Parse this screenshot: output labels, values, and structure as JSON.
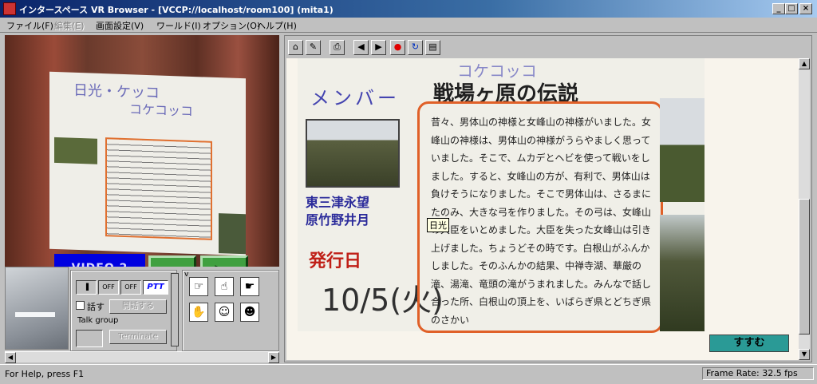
{
  "window": {
    "title": "インタースペース VR Browser  - [VCCP://localhost/room100] (mita1)",
    "min_glyph": "_",
    "max_glyph": "□",
    "close_glyph": "×"
  },
  "menu": {
    "items": [
      {
        "label": "ファイル(F)",
        "enabled": true
      },
      {
        "label": "編集(E)",
        "enabled": false
      },
      {
        "label": "画面設定(V)",
        "enabled": true
      },
      {
        "label": "ワールド(I)",
        "enabled": true
      },
      {
        "label": "オプション(O)",
        "enabled": true
      },
      {
        "label": "ヘルプ(H)",
        "enabled": true
      }
    ]
  },
  "viewport": {
    "board_title_1": "日光・ケッコ",
    "board_title_2": "コケコッコ",
    "video_label": "VIDEO 2",
    "rewind_icon": "rewind-icon",
    "play_icon": "play-icon"
  },
  "controls": {
    "v_label": "v",
    "toggles": [
      {
        "label": "▐",
        "name": "mic-toggle"
      },
      {
        "label": "OFF",
        "name": "off-toggle-1"
      },
      {
        "label": "OFF",
        "name": "off-toggle-2"
      },
      {
        "label": "PTT",
        "name": "ptt-toggle"
      }
    ],
    "talk_label": "話す",
    "start_talk_label": "開話する",
    "talk_group_label": "Talk group",
    "terminate_label": "Terminate",
    "gestures": [
      "bow-gesture-icon",
      "wave-gesture-icon",
      "point-gesture-icon",
      "clap-gesture-icon",
      "refuse-gesture-icon",
      "cheer-gesture-icon"
    ]
  },
  "browser": {
    "toolbar": [
      {
        "name": "home-icon",
        "glyph": "⌂"
      },
      {
        "name": "edit-icon",
        "glyph": "✎"
      },
      {
        "name": "print-icon",
        "glyph": "⎙"
      },
      {
        "name": "back-icon",
        "glyph": "◀"
      },
      {
        "name": "forward-icon",
        "glyph": "▶"
      },
      {
        "name": "stop-icon",
        "glyph": "●"
      },
      {
        "name": "reload-icon",
        "glyph": "↻"
      },
      {
        "name": "bookmark-icon",
        "glyph": "▤"
      }
    ],
    "poster": {
      "top_text": "コケコッコ",
      "member_label": "メンバー",
      "legend_title": "戦場ヶ原の伝説",
      "names_line1": "東三津永望",
      "names_line2": "原竹野井月",
      "pub_label": "発行日",
      "pub_date": "10/5(火)",
      "story": "昔々、男体山の神様と女峰山の神様がいました。女峰山の神様は、男体山の神様がうらやましく思っていました。そこで、ムカデとヘビを使って戦いをしました。すると、女峰山の方が、有利で、男体山は負けそうになりました。そこで男体山は、さるまに たのみ、大きな弓を作りました。その弓は、女峰山の大臣をいとめました。大臣を失った女峰山は引き上げました。ちょうどその時です。白根山がふんかしました。そのふんかの結果、中禅寺湖、華厳の滝、湯滝、竜頭の滝がうまれました。みんなで話し合った所、白根山の頂上を、いばらぎ県とどちぎ県のさかい"
    },
    "tooltip": "日光",
    "next_button": "すすむ"
  },
  "status": {
    "help_text": "For Help, press F1",
    "frame_rate": "Frame Rate: 32.5 fps"
  }
}
